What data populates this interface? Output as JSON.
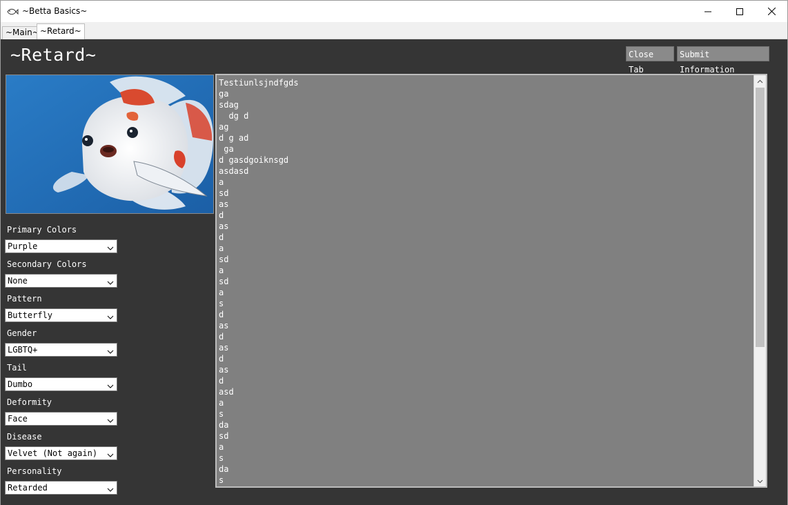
{
  "window": {
    "title": "~Betta Basics~",
    "icon": "fish-icon",
    "controls": [
      "minimize-icon",
      "maximize-icon",
      "close-icon"
    ]
  },
  "tabs": [
    {
      "label": "~Main~",
      "selected": false
    },
    {
      "label": "~Retard~",
      "selected": true
    }
  ],
  "page": {
    "title": "~Retard~",
    "close_tab_label": "Close Tab",
    "submit_label": "Submit Information"
  },
  "fields": [
    {
      "label": "Primary Colors",
      "value": "Purple"
    },
    {
      "label": "Secondary Colors",
      "value": "None"
    },
    {
      "label": "Pattern",
      "value": "Butterfly"
    },
    {
      "label": "Gender",
      "value": "LGBTQ+"
    },
    {
      "label": "Tail",
      "value": "Dumbo"
    },
    {
      "label": "Deformity",
      "value": "Face"
    },
    {
      "label": "Disease",
      "value": "Velvet (Not again)"
    },
    {
      "label": "Personality",
      "value": "Retarded"
    }
  ],
  "notes_lines": [
    "Testiunlsjndfgds",
    "ga",
    "sdag",
    "  dg d",
    "ag",
    "d g ad",
    " ga",
    "d gasdgoiknsgd",
    "asdasd",
    "a",
    "sd",
    "as",
    "d",
    "as",
    "d",
    "a",
    "sd",
    "a",
    "sd",
    "a",
    "s",
    "d",
    "as",
    "d",
    "as",
    "d",
    "as",
    "d",
    "asd",
    "a",
    "s",
    "da",
    "sd",
    "a",
    "s",
    "da",
    "s"
  ],
  "colors": {
    "content_bg": "#353535",
    "button_bg": "#8a8a8a",
    "textarea_bg": "#808080",
    "fish_water": "#1f6fb8"
  }
}
